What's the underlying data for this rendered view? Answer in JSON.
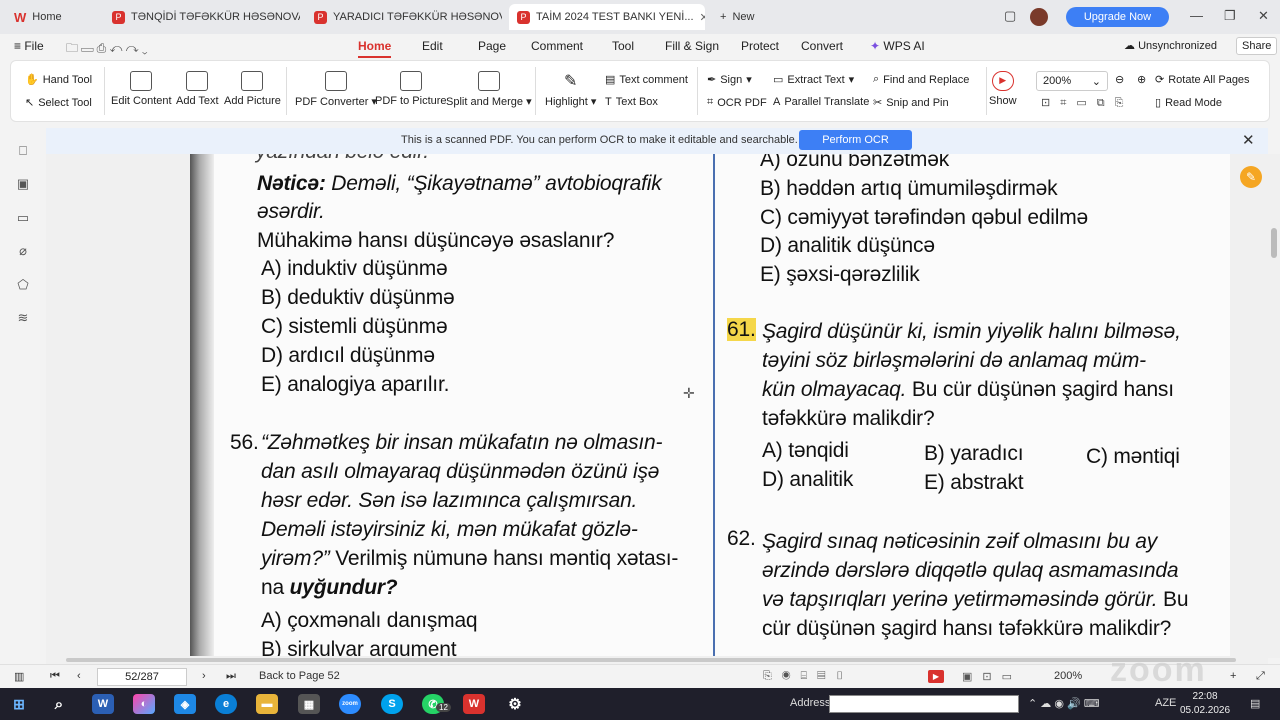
{
  "tabs": [
    {
      "label": "Home"
    },
    {
      "label": "TƏNQİDİ TƏFƏKKÜR HƏSƏNOVA Ş..."
    },
    {
      "label": "YARADICI TƏFƏKKÜR HƏSƏNOVA..."
    },
    {
      "label": "TAİM 2024 TEST BANKI YENİ..."
    },
    {
      "label": "New"
    }
  ],
  "window": {
    "upgrade_label": "Upgrade Now",
    "minimize": "—",
    "restore": "❐",
    "close": "✕"
  },
  "menu": {
    "file": "File",
    "items": [
      "Home",
      "Edit",
      "Page",
      "Comment",
      "Tool",
      "Fill & Sign",
      "Protect",
      "Convert",
      "WPS AI"
    ],
    "unsync": "Unsynchronized",
    "share": "Share"
  },
  "ribbon": {
    "hand_tool": "Hand Tool",
    "select_tool": "Select Tool",
    "edit_content": "Edit Content",
    "add_text": "Add Text",
    "add_picture": "Add Picture",
    "pdf_converter": "PDF Converter",
    "pdf_to_picture": "PDF to Picture",
    "split_merge": "Split and Merge",
    "highlight": "Highlight",
    "text_comment": "Text comment",
    "text_box": "Text Box",
    "sign": "Sign",
    "ocr_pdf": "OCR PDF",
    "extract_text": "Extract Text",
    "parallel_translate": "Parallel Translate",
    "find_replace": "Find and Replace",
    "snip_pin": "Snip and Pin",
    "show": "Show",
    "zoom": "200%",
    "rotate_all": "Rotate All Pages",
    "read_mode": "Read Mode"
  },
  "ocr_banner": {
    "message": "This is a scanned PDF. You can perform OCR to make it editable and searchable.",
    "button": "Perform OCR"
  },
  "doc": {
    "left": {
      "cut_top": "yazından belə edir.",
      "netice_label": "Nəticə:",
      "netice_text": " Deməli, “Şikayətnamə” avtobioqrafik",
      "netice_text2": "əsərdir.",
      "q55_stem": "Mühakimə hansı düşüncəyə əsaslanır?",
      "q55_options": [
        "A) induktiv düşünmə",
        "B) deduktiv düşünmə",
        "C) sistemli düşünmə",
        "D) ardıcıl düşünmə",
        "E) analogiya aparılır."
      ],
      "q56_num": "56.",
      "q56_lines": [
        "“Zəhmətkeş bir insan mükafatın nə olmasın-",
        "dan asılı olmayaraq düşünmədən özünü işə",
        "həsr edər. Sən isə lazımınca çalışmırsan.",
        "Deməli istəyirsiniz ki, mən mükafat gözlə-",
        "yirəm?”"
      ],
      "q56_tail1": " Verilmiş nümunə hansı məntiq xətası-",
      "q56_tail2a": "na ",
      "q56_tail2b": "uyğundur?",
      "q56_options": [
        "A) çoxmənalı danışmaq",
        "B) sirkulyar arqument"
      ]
    },
    "right": {
      "prev_options": [
        "A) özünü bənzətmək",
        "B) həddən artıq ümumiləşdirmək",
        "C) cəmiyyət tərəfindən qəbul edilmə",
        "D) analitik düşüncə",
        "E) şəxsi-qərəzlilik"
      ],
      "q61_num": "61.",
      "q61_lines": [
        "Şagird düşünür ki, ismin yiyəlik halını bilməsə,",
        "təyini söz birləşmələrini də anlamaq müm-"
      ],
      "q61_line3a": "kün olmayacaq.",
      "q61_line3b": " Bu cür düşünən şagird hansı",
      "q61_line4": "təfəkkürə malikdir?",
      "q61_options": [
        "A) tənqidi",
        "B) yaradıcı",
        "C) məntiqi",
        "D) analitik",
        "E) abstrakt"
      ],
      "q62_num": "62.",
      "q62_lines": [
        "Şagird sınaq nəticəsinin zəif olmasını bu ay",
        "ərzində dərslərə diqqətlə qulaq asmamasında"
      ],
      "q62_line3a": "və tapşırıqları yerinə yetirməməsində görür.",
      "q62_line3b": " Bu",
      "q62_line4": "cür düşünən şagird hansı təfəkkürə malikdir?"
    }
  },
  "status": {
    "page_value": "52/287",
    "back_to": "Back to Page 52",
    "zoom": "200%",
    "watermark": "zoom"
  },
  "taskbar": {
    "address_label": "Address",
    "whatsapp_badge": "12",
    "lang": "AZE",
    "time": "22:08",
    "date": "05.02.2026"
  }
}
